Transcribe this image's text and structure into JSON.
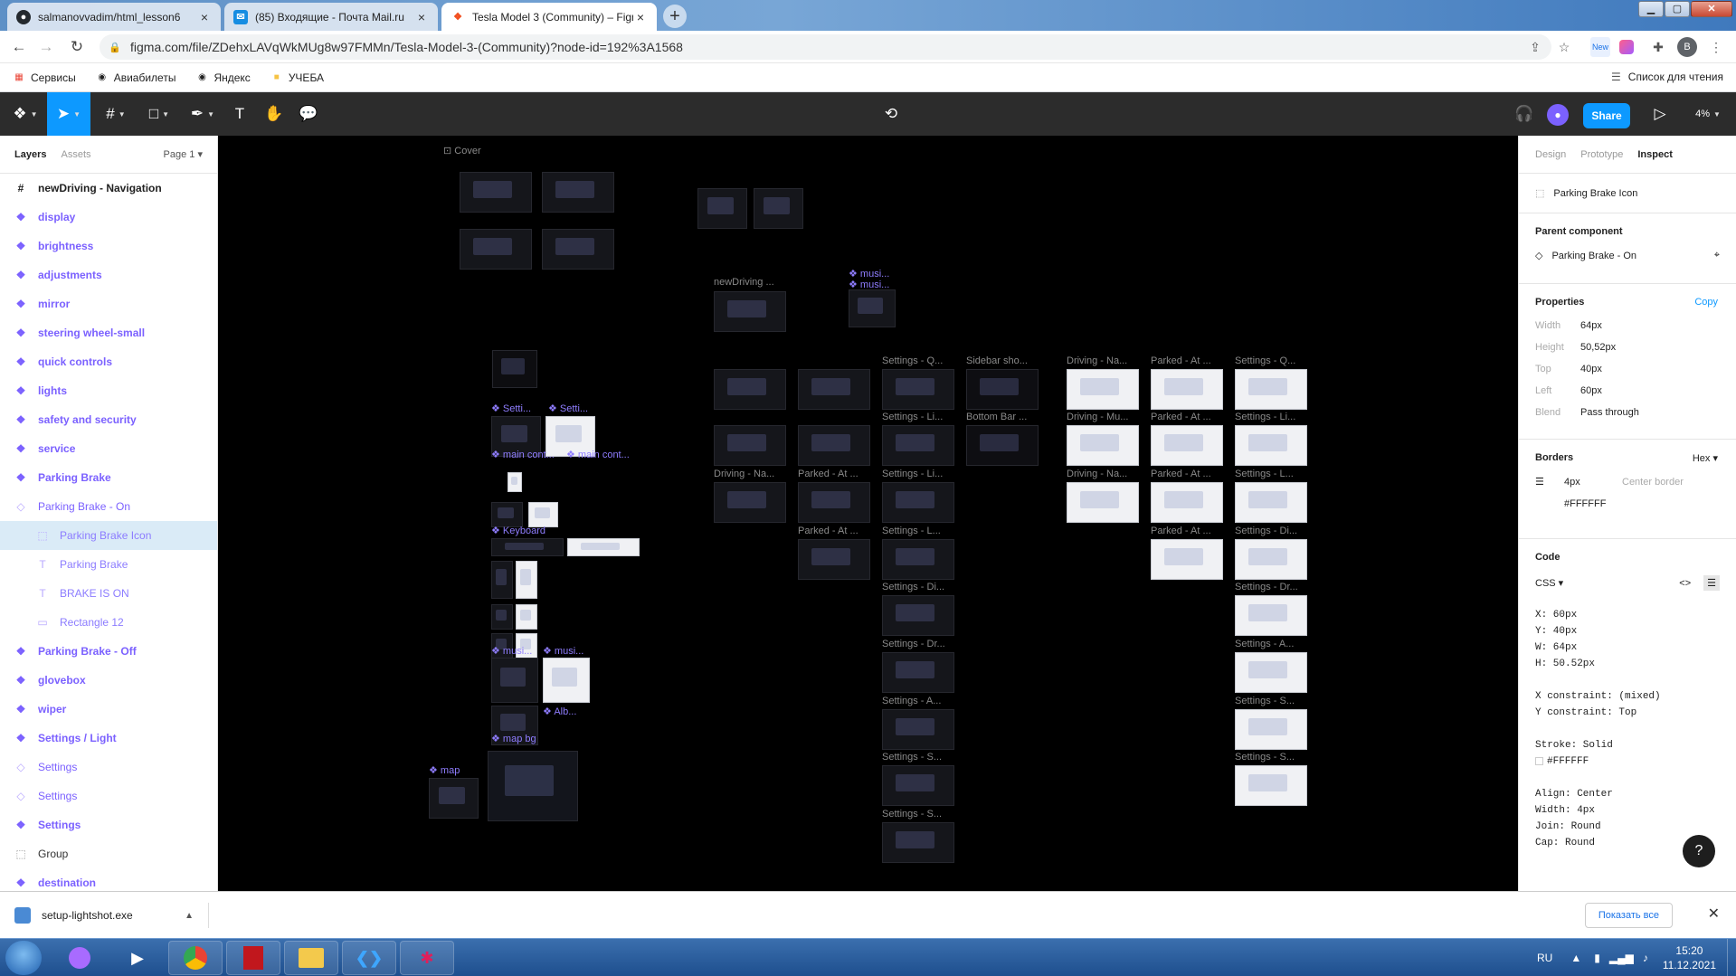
{
  "browser": {
    "tabs": [
      {
        "title": "salmanovvadim/html_lesson6",
        "active": false
      },
      {
        "title": "(85) Входящие - Почта Mail.ru",
        "active": false
      },
      {
        "title": "Tesla Model 3 (Community) – Figma",
        "active": true
      }
    ],
    "new_tab": "+",
    "url": "figma.com/file/ZDehxLAVqWkMUg8w97FMMn/Tesla-Model-3-(Community)?node-id=192%3A1568",
    "profile_initial": "B",
    "ext_badge": "New"
  },
  "bookmarks": {
    "items": [
      "Сервисы",
      "Авиабилеты",
      "Яндекс",
      "УЧЕБА"
    ],
    "reading_list": "Список для чтения"
  },
  "figma_toolbar": {
    "share_label": "Share",
    "zoom": "4%"
  },
  "left_panel": {
    "tabs": [
      "Layers",
      "Assets"
    ],
    "page": "Page 1",
    "layers": [
      {
        "name": "newDriving - Navigation",
        "kind": "frame",
        "indent": 0
      },
      {
        "name": "display",
        "kind": "comp",
        "indent": 0
      },
      {
        "name": "brightness",
        "kind": "comp",
        "indent": 0
      },
      {
        "name": "adjustments",
        "kind": "comp",
        "indent": 0
      },
      {
        "name": "mirror",
        "kind": "comp",
        "indent": 0
      },
      {
        "name": "steering wheel-small",
        "kind": "comp",
        "indent": 0
      },
      {
        "name": "quick controls",
        "kind": "comp",
        "indent": 0
      },
      {
        "name": "lights",
        "kind": "comp",
        "indent": 0
      },
      {
        "name": "safety and security",
        "kind": "comp",
        "indent": 0
      },
      {
        "name": "service",
        "kind": "comp",
        "indent": 0
      },
      {
        "name": "Parking Brake",
        "kind": "comp",
        "indent": 0
      },
      {
        "name": "Parking Brake - On",
        "kind": "variant",
        "indent": 0
      },
      {
        "name": "Parking Brake Icon",
        "kind": "child-frame",
        "indent": 1,
        "selected": true
      },
      {
        "name": "Parking Brake",
        "kind": "child-text",
        "indent": 1
      },
      {
        "name": "BRAKE IS ON",
        "kind": "child-text",
        "indent": 1
      },
      {
        "name": "Rectangle 12",
        "kind": "child-rect",
        "indent": 1
      },
      {
        "name": "Parking Brake - Off",
        "kind": "comp",
        "indent": 0
      },
      {
        "name": "glovebox",
        "kind": "comp",
        "indent": 0
      },
      {
        "name": "wiper",
        "kind": "comp",
        "indent": 0
      },
      {
        "name": "Settings / Light",
        "kind": "comp",
        "indent": 0
      },
      {
        "name": "Settings",
        "kind": "variant",
        "indent": 0
      },
      {
        "name": "Settings",
        "kind": "variant",
        "indent": 0
      },
      {
        "name": "Settings",
        "kind": "comp",
        "indent": 0
      },
      {
        "name": "Group",
        "kind": "group",
        "indent": 0
      },
      {
        "name": "destination",
        "kind": "comp",
        "indent": 0
      }
    ]
  },
  "canvas_labels": [
    "Cover",
    "newDriving ...",
    "musi...",
    "musi...",
    "Setti...",
    "Setti...",
    "main cont...",
    "main cont...",
    "Settings - Q...",
    "Sidebar sho...",
    "Bottom Bar ...",
    "Settings - Li...",
    "Settings - Li...",
    "Settings - L...",
    "Settings - Di...",
    "Settings - Dr...",
    "Settings - A...",
    "Settings - S...",
    "Settings - S...",
    "Driving - Na...",
    "Parked - At ...",
    "Parked - At ...",
    "Driving - Na...",
    "Parked - At ...",
    "Settings - Q...",
    "Driving - Mu...",
    "Parked - At ...",
    "Settings - Li...",
    "Driving - Na...",
    "Parked - At ...",
    "Settings - L...",
    "Parked - At ...",
    "Settings - Di...",
    "Settings - Dr...",
    "Settings - A...",
    "Settings - S...",
    "Settings - S...",
    "map",
    "map bg",
    "Keyboard",
    "musi...",
    "musi...",
    "Alb..."
  ],
  "right_panel": {
    "tabs": [
      "Design",
      "Prototype",
      "Inspect"
    ],
    "selection": "Parking Brake Icon",
    "parent_component_title": "Parent component",
    "parent_component": "Parking Brake - On",
    "properties_title": "Properties",
    "copy_label": "Copy",
    "props": [
      {
        "k": "Width",
        "v": "64px"
      },
      {
        "k": "Height",
        "v": "50,52px"
      },
      {
        "k": "Top",
        "v": "40px"
      },
      {
        "k": "Left",
        "v": "60px"
      },
      {
        "k": "Blend",
        "v": "Pass through"
      }
    ],
    "borders_title": "Borders",
    "color_format": "Hex",
    "border_width": "4px",
    "border_position": "Center border",
    "border_color": "#FFFFFF",
    "code_title": "Code",
    "code_lang": "CSS",
    "code_lines": [
      "X: 60px",
      "Y: 40px",
      "W: 64px",
      "H: 50.52px",
      "",
      "X constraint: (mixed)",
      "Y constraint: Top",
      "",
      "Stroke: Solid",
      "#FFFFFF",
      "",
      "Align: Center",
      "Width: 4px",
      "Join: Round",
      "Cap: Round"
    ],
    "help": "?"
  },
  "download_bar": {
    "file": "setup-lightshot.exe",
    "show_all": "Показать все"
  },
  "taskbar": {
    "lang": "RU",
    "time": "15:20",
    "date": "11.12.2021"
  },
  "colors": {
    "accent": "#0d99ff",
    "component": "#7b61ff",
    "canvas": "#000000",
    "toolbar": "#2c2c2c",
    "selection": "#daebf7"
  }
}
